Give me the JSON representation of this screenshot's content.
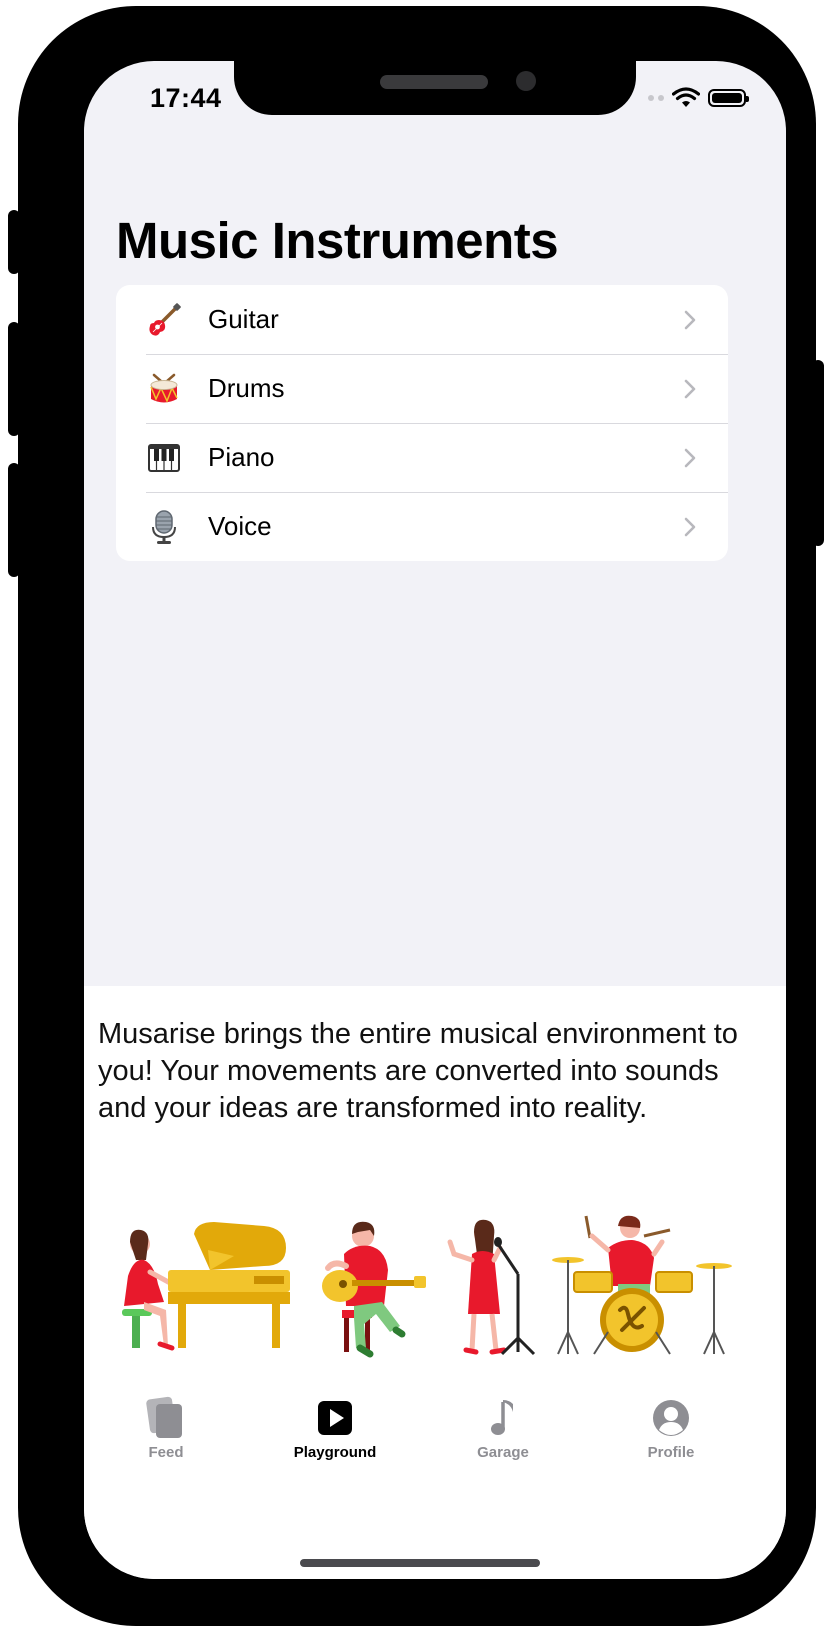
{
  "status_bar": {
    "time": "17:44"
  },
  "page_title": "Music Instruments",
  "instruments": [
    {
      "label": "Guitar",
      "icon": "guitar-icon"
    },
    {
      "label": "Drums",
      "icon": "drum-icon"
    },
    {
      "label": "Piano",
      "icon": "piano-keys-icon"
    },
    {
      "label": "Voice",
      "icon": "microphone-icon"
    }
  ],
  "description": "Musarise brings the entire musical environment to you! Your movements are converted into sounds and your ideas are transformed into reality.",
  "tabbar": {
    "items": [
      {
        "label": "Feed",
        "icon": "cards-icon",
        "active": false
      },
      {
        "label": "Playground",
        "icon": "play-square-icon",
        "active": true
      },
      {
        "label": "Garage",
        "icon": "music-note-icon",
        "active": false
      },
      {
        "label": "Profile",
        "icon": "person-circle-icon",
        "active": false
      }
    ]
  },
  "colors": {
    "background": "#f2f2f7",
    "accent_red": "#e8192c",
    "accent_gold": "#f2c42c",
    "inactive_tab": "#8e8e93"
  }
}
